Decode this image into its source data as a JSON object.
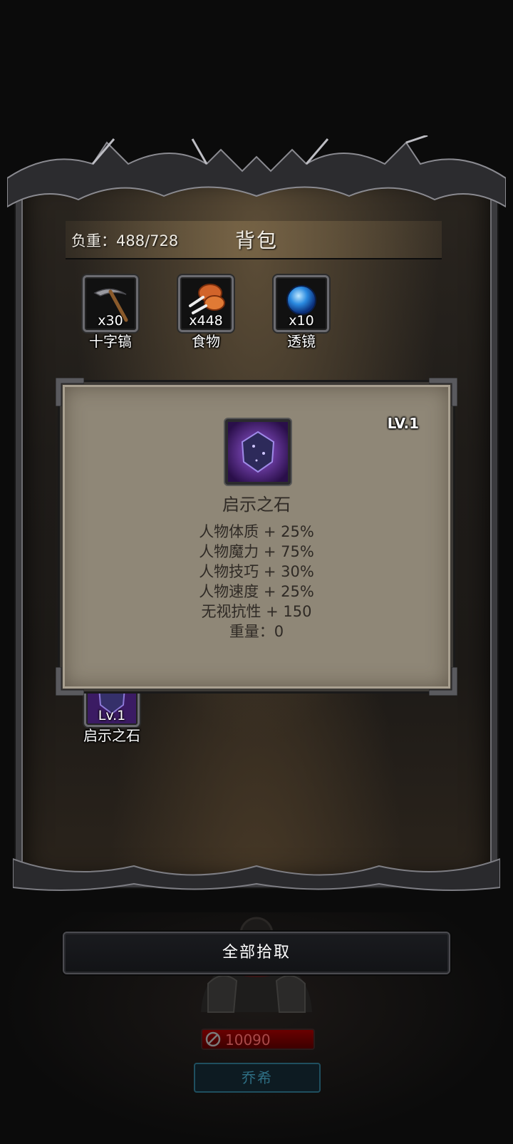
{
  "header": {
    "weight_label": "负重：488/728",
    "title": "背包"
  },
  "resources": [
    {
      "name": "十字镐",
      "count": "x30",
      "icon": "pickaxe-icon"
    },
    {
      "name": "食物",
      "count": "x448",
      "icon": "meat-icon"
    },
    {
      "name": "透镜",
      "count": "x10",
      "icon": "lens-orb-icon"
    }
  ],
  "inventory": [
    {
      "name": "启示之石",
      "level": "Lv.1",
      "icon": "revelation-stone-icon"
    }
  ],
  "detail": {
    "level": "LV.1",
    "name": "启示之石",
    "icon": "revelation-stone-icon",
    "stats": [
      "人物体质 + 25%",
      "人物魔力 + 75%",
      "人物技巧 + 30%",
      "人物速度 + 25%",
      "无视抗性 + 150",
      "重量：0"
    ]
  },
  "actions": {
    "pickup_all": "全部拾取"
  },
  "character": {
    "hp": "10090",
    "name": "乔希"
  },
  "colors": {
    "panel_bg": "#8f8777",
    "hp_red": "#6a0000",
    "stone_purple": "#6a3fb0"
  }
}
